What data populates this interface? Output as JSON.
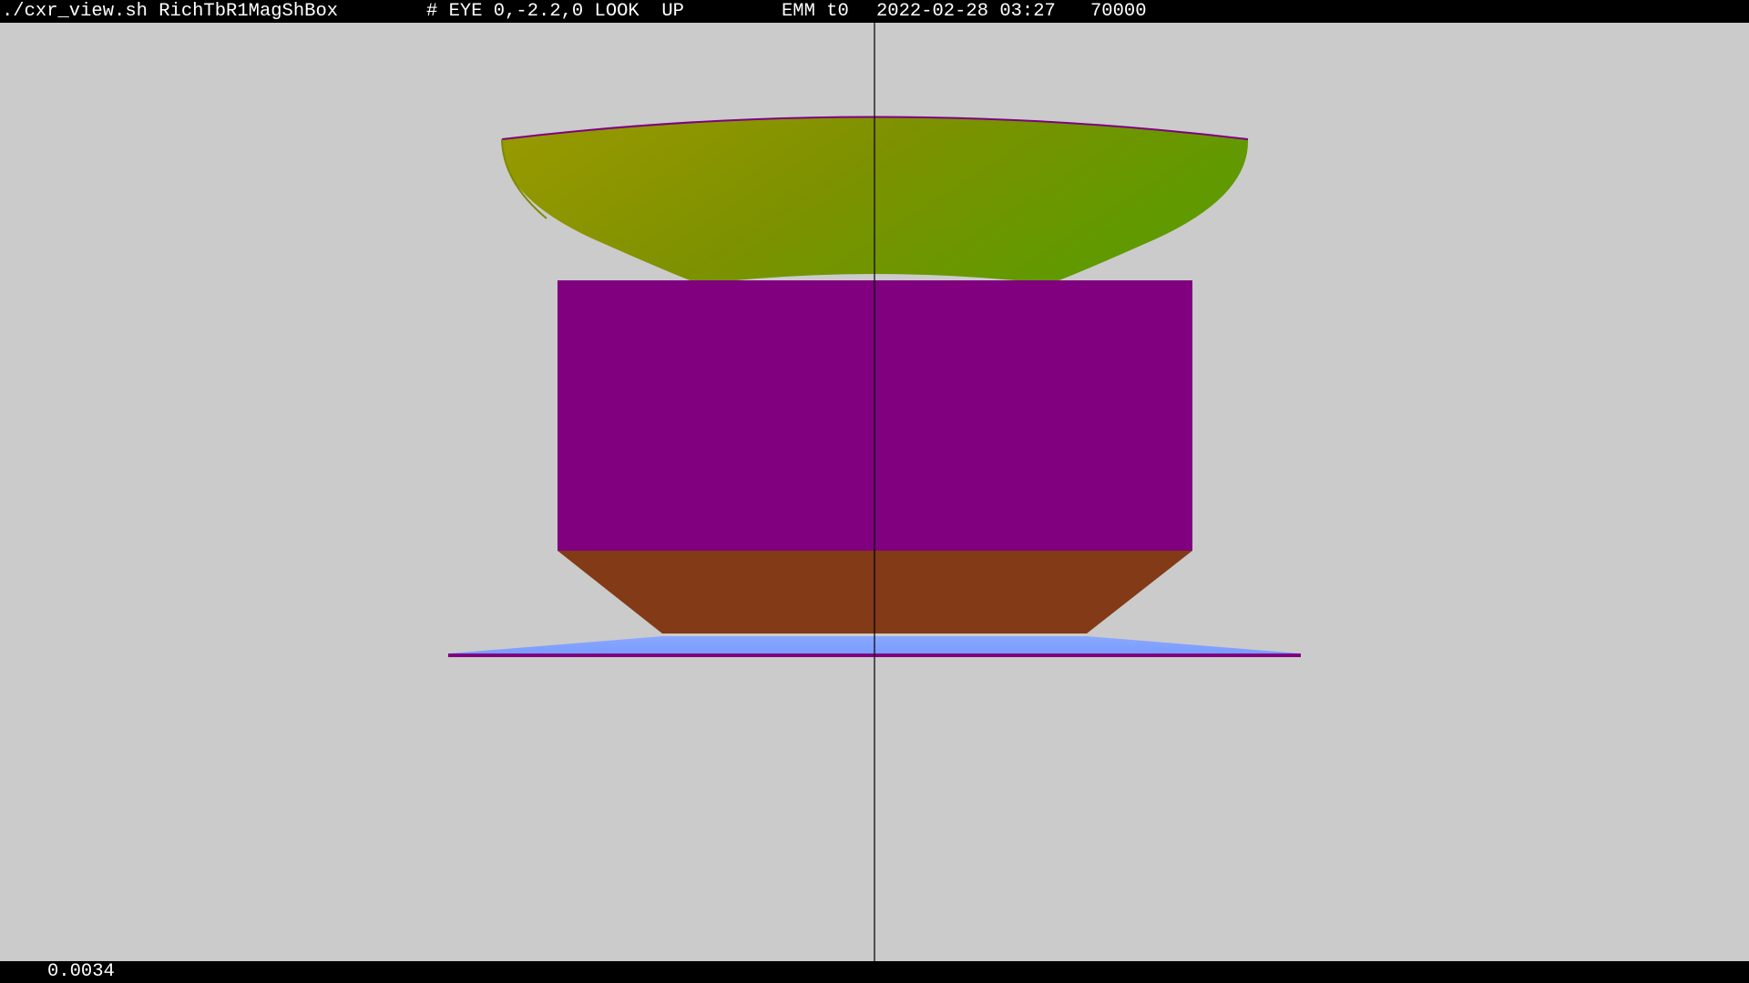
{
  "header": {
    "command": "./cxr_view.sh RichTbR1MagShBox",
    "view": "# EYE 0,-2.2,0 LOOK  UP",
    "mode": "EMM t0",
    "timestamp": "2022-02-28 03:27",
    "count": "70000"
  },
  "footer": {
    "time_value": "0.0034"
  },
  "colors": {
    "background": "#cbcbcb",
    "bars": "#000000",
    "top_shape_left": "#929a00",
    "top_shape_right": "#6a9800",
    "box": "#800080",
    "base": "#823a17",
    "disk": "#82a3ff",
    "outline": "#800080",
    "crosshair": "#000000"
  }
}
